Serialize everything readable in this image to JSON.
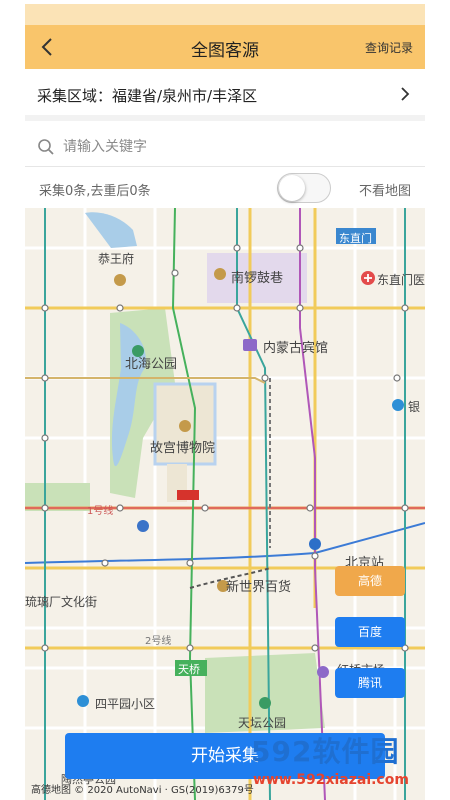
{
  "header": {
    "title": "全图客源",
    "record_label": "查询记录"
  },
  "region": {
    "text": "采集区域：福建省/泉州市/丰泽区"
  },
  "search": {
    "placeholder": "请输入关键字"
  },
  "stats": {
    "text": "采集0条,去重后0条",
    "no_map_label": "不看地图",
    "toggle_on": false
  },
  "map": {
    "labels": {
      "gongwangfu": "恭王府",
      "nanluoguxiang": "南锣鼓巷",
      "dongzhimen": "东直门",
      "dongzhimen_hospital": "东直门医",
      "beihai": "北海公园",
      "neimeng": "内蒙古宾馆",
      "gugong": "故宫博物院",
      "yin": "银",
      "line1": "1号线",
      "beijingzhan": "北京站",
      "xinshijie": "新世界百货",
      "liulichang": "琉璃厂文化街",
      "line2": "2号线",
      "tianqiao": "天桥",
      "siping": "四平园小区",
      "tiantan": "天坛公园",
      "taoranting": "陶然亭公园",
      "hongqiao": "红桥市场",
      "copyright": "高德地图 © 2020 AutoNavi · GS(2019)6379号"
    }
  },
  "providers": [
    {
      "label": "高德",
      "color": "#f0a84b"
    },
    {
      "label": "百度",
      "color": "#1e7df0"
    },
    {
      "label": "腾讯",
      "color": "#1e7df0"
    }
  ],
  "start_label": "开始采集",
  "watermark": {
    "big": "592软件园",
    "small": "www.592xiazai.com"
  }
}
